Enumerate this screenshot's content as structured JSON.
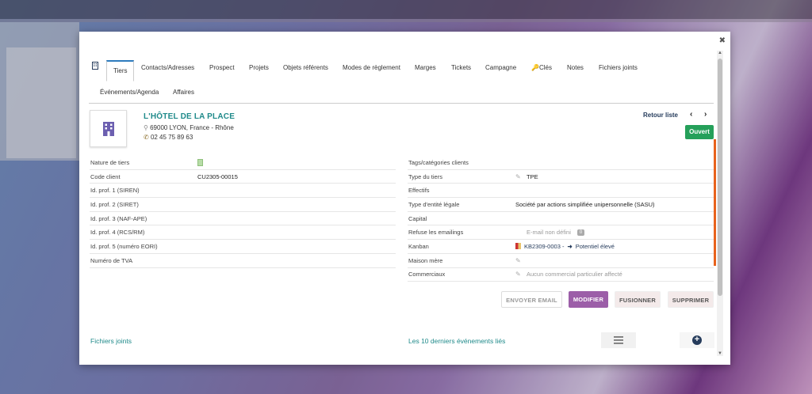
{
  "tabs": [
    {
      "label": ""
    },
    {
      "label": "Tiers"
    },
    {
      "label": "Contacts/Adresses"
    },
    {
      "label": "Prospect"
    },
    {
      "label": "Projets"
    },
    {
      "label": "Objets référents"
    },
    {
      "label": "Modes de règlement"
    },
    {
      "label": "Marges"
    },
    {
      "label": "Tickets"
    },
    {
      "label": "Campagne"
    },
    {
      "label": "Clés"
    },
    {
      "label": "Notes"
    },
    {
      "label": "Fichiers joints"
    },
    {
      "label": "Événements/Agenda"
    },
    {
      "label": "Affaires"
    }
  ],
  "header": {
    "name": "L'HÔTEL DE LA PLACE",
    "address": "69000 LYON, France - Rhône",
    "phone": "02 45 75 89 63",
    "back_label": "Retour liste",
    "status": "Ouvert"
  },
  "left_fields": [
    {
      "label": "Nature de tiers",
      "value": ""
    },
    {
      "label": "Code client",
      "value": "CU2305-00015"
    },
    {
      "label": "Id. prof. 1 (SIREN)",
      "value": ""
    },
    {
      "label": "Id. prof. 2 (SIRET)",
      "value": ""
    },
    {
      "label": "Id. prof. 3 (NAF-APE)",
      "value": ""
    },
    {
      "label": "Id. prof. 4 (RCS/RM)",
      "value": ""
    },
    {
      "label": "Id. prof. 5 (numéro EORI)",
      "value": ""
    },
    {
      "label": "Numéro de TVA",
      "value": ""
    }
  ],
  "right_fields": [
    {
      "label": "Tags/catégories clients",
      "value": ""
    },
    {
      "label": "Type du tiers",
      "value": "TPE"
    },
    {
      "label": "Effectifs",
      "value": ""
    },
    {
      "label": "Type d'entité légale",
      "value": "Société par actions simplifiée unipersonnelle (SASU)"
    },
    {
      "label": "Capital",
      "value": ""
    },
    {
      "label": "Refuse les emailings",
      "value": "E-mail non défini",
      "badge": "0"
    },
    {
      "label": "Kanban",
      "value": "KB2309-0003 -",
      "extra": "Potentiel élevé"
    },
    {
      "label": "Maison mère",
      "value": ""
    },
    {
      "label": "Commerciaux",
      "value": "Aucun commercial particulier affecté"
    }
  ],
  "buttons": {
    "email": "ENVOYER EMAIL",
    "modify": "MODIFIER",
    "merge": "FUSIONNER",
    "delete": "SUPPRIMER"
  },
  "sections": {
    "files": "Fichiers joints",
    "events": "Les 10 derniers événements liés"
  },
  "colors": {
    "teal": "#1f8a8a",
    "status_green": "#25a05a",
    "modify_purple": "#9c5ea8",
    "navy": "#263c5c"
  }
}
